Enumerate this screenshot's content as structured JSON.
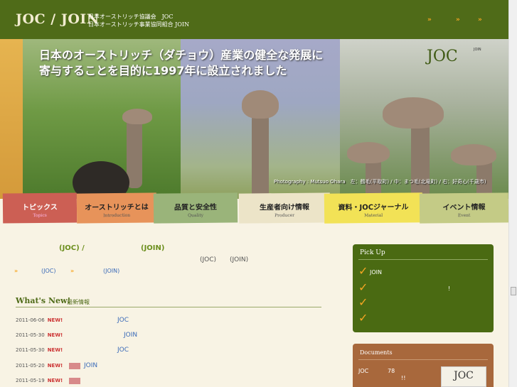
{
  "header": {
    "logo": "JOC / JOIN",
    "org_line1": "日本オーストリッチ協議会　JOC",
    "org_line2": "日本オーストリッチ事業協同組合 JOIN",
    "links": [
      "»",
      "»",
      "»"
    ]
  },
  "hero": {
    "title_line1": "日本のオーストリッチ（ダチョウ）産業の健全な発展に",
    "title_line2": "寄与することを目的に1997年に設立されました",
    "logo_joc": "JOC",
    "logo_join": "JOIN",
    "photo_credit": "Photography : Mutsuo Ohara　左：鶴毛(平取町) / 中：まつ毛(北竜町) / 右：好奇心(千歳市)"
  },
  "nav": {
    "tabs": [
      {
        "jp": "トピックス",
        "en": "Topics"
      },
      {
        "jp": "オーストリッチとは",
        "en": "Introduction"
      },
      {
        "jp": "品質と安全性",
        "en": "Quality"
      },
      {
        "jp": "生産者向け情報",
        "en": "Producer"
      },
      {
        "jp": "資料・JOCジャーナル",
        "en": "Material"
      },
      {
        "jp": "イベント情報",
        "en": "Event"
      }
    ]
  },
  "intro": {
    "joc_label": "(JOC) /",
    "join_label": "(JOIN)",
    "line2_joc": "(JOC)",
    "line2_join": "(JOIN)",
    "link1_arrow": "»",
    "link1_text": "(JOC)",
    "link2_arrow": "»",
    "link2_text": "(JOIN)"
  },
  "news": {
    "title": "What's New!",
    "title_jp": "最新情報",
    "new_label": "NEW!",
    "items": [
      {
        "date": "2011-06-06",
        "text": "JOC"
      },
      {
        "date": "2011-05-30",
        "text": "JOIN"
      },
      {
        "date": "2011-05-30",
        "text": "JOC"
      },
      {
        "date": "2011-05-20",
        "text": "JOIN"
      },
      {
        "date": "2011-05-19",
        "text": ""
      }
    ]
  },
  "pickup": {
    "title": "Pick Up",
    "items": [
      "JOIN",
      "!",
      "",
      ""
    ]
  },
  "documents": {
    "title": "Documents",
    "text_joc": "JOC",
    "text_num": "78",
    "text_excl": "!!",
    "journal_image_text": "JOC"
  },
  "colors": {
    "header_bg": "#4f6b18",
    "accent_orange": "#f6a623",
    "link_blue": "#3a6ab8",
    "new_red": "#cc3333",
    "docs_bg": "#a8683c"
  }
}
